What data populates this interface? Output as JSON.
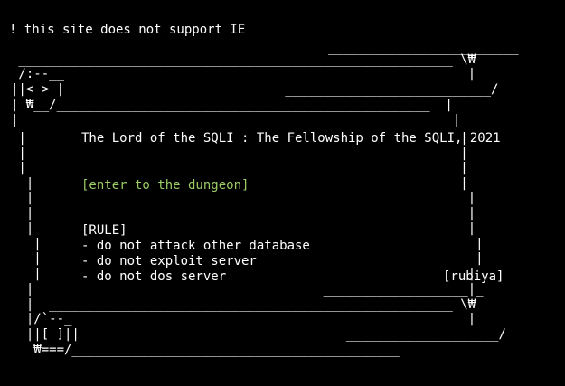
{
  "notice": "! this site does not support IE",
  "scroll": {
    "title": "The Lord of the SQLI : The Fellowship of the SQLI, 2021",
    "enter_link": "[enter to the dungeon]",
    "rule_heading": "[RULE]",
    "rules": [
      "- do not attack other database",
      "- do not exploit server",
      "- do not dos server"
    ],
    "author": "[rubiya]",
    "link_color": "#9acd66"
  }
}
